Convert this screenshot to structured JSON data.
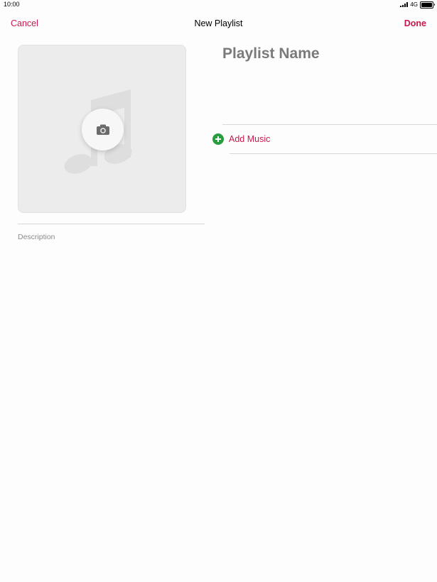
{
  "status_bar": {
    "time": "10:00",
    "network": "4G",
    "battery_level": 1.0
  },
  "nav": {
    "cancel_label": "Cancel",
    "title": "New Playlist",
    "done_label": "Done"
  },
  "artwork": {
    "placeholder_icon": "music-note-icon",
    "button_icon": "camera-icon"
  },
  "form": {
    "name_placeholder": "Playlist Name",
    "description_placeholder": "Description"
  },
  "add_music": {
    "label": "Add Music",
    "icon": "plus-circle-icon"
  },
  "colors": {
    "accent": "#c8184c",
    "add_icon": "#2a9d3f",
    "artwork_bg": "#ececec"
  }
}
